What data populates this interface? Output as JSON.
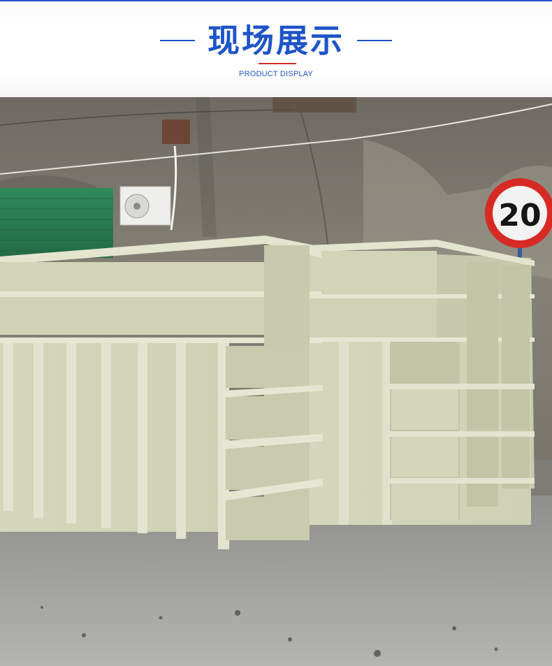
{
  "header": {
    "title": "现场展示",
    "subtitle": "PRODUCT DISPLAY"
  },
  "photo": {
    "sign_text": "20"
  },
  "colors": {
    "accent_blue": "#1f54c8",
    "accent_red": "#d42b2b",
    "tank_color": "#d9dcc0"
  }
}
